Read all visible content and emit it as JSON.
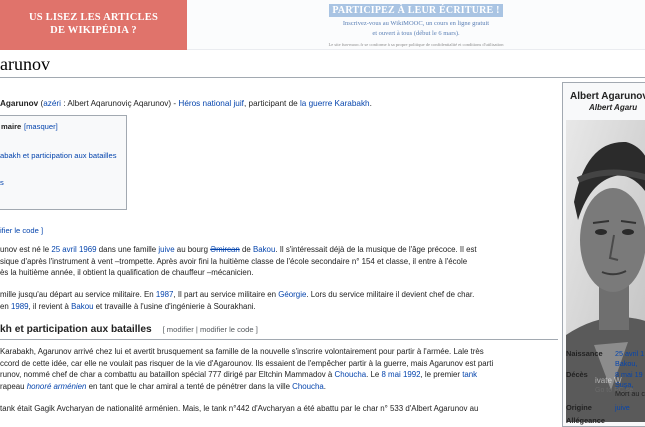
{
  "banner": {
    "left_line1": "US LISEZ LES ARTICLES",
    "left_line2": "DE WIKIPÉDIA ?",
    "headline": "PARTICIPEZ À LEUR ÉCRITURE !",
    "sub1": "Inscrivez-vous au WikiMOOC, un cours en ligne gratuit",
    "sub2": "et ouvert à tous (début le 6 mars).",
    "fine": "Le site fun-mooc.fr se conforme à sa propre politique de confidentialité et conditions d'utilisation"
  },
  "page": {
    "title": "arunov",
    "intro": {
      "name": "Agarunov",
      "lang_link": "azéri",
      "native": ": Albert Aqarunoviç Aqarunov) -",
      "hero_link": "Héros national juif",
      "mid": ", participant de",
      "war_link": "la guerre Karabakh",
      "end": "."
    }
  },
  "toc": {
    "title": "maire",
    "hide": "[masquer]",
    "item1": "abakh et participation aux batailles",
    "item2": "s"
  },
  "edit_code": "ifier le code ]",
  "para1": {
    "l1a": "unov est né le ",
    "l1_date": "25 avril 1969",
    "l1b": " dans une famille ",
    "l1_juive": "juive",
    "l1c": " au bourg ",
    "l1_place": "Əmircan",
    "l1d": " de ",
    "l1_baku": "Bakou",
    "l1e": ". Il s'intéressait déjà de la musique de l'âge précoce. Il est",
    "l2": "sique d'après l'instrument à vent –trompette. Après avoir fini la huitième classe de l'école secondaire n° 154 et classe, il entre à l'école",
    "l3": "ès la huitième année, il obtient la qualification de chauffeur –mécanicien."
  },
  "para2": {
    "l1a": "mille jusqu'au départ au service militaire. En ",
    "l1_year": "1987",
    "l1b": ", Il part au service militaire en ",
    "l1_geo": "Géorgie",
    "l1c": ". Lors du service militaire il devient chef de char.",
    "l2a": "en ",
    "l2_year": "1989",
    "l2b": ", il revient à ",
    "l2_baku": "Bakou",
    "l2c": " et travaille à l'usine d'ingénierie à Sourakhani."
  },
  "section": {
    "heading": "kh et participation aux batailles",
    "edits": "[ modifier | modifier le code ]"
  },
  "para3": {
    "l1": "Karabakh, Agarunov arrivé chez lui et avertit brusquement sa famille de la nouvelle s'inscrire volontairement pour partir à l'armée. Lale très",
    "l2": "ccord de cette idée, car elle ne voulait pas risquer de la vie d'Agarounov. Ils essaient de l'empêcher partir à la guerre, mais Agarunov est parti",
    "l3a": "runov, nommé chef de char a combattu au bataillon spécial 777 dirigé par Eltchin Mammadov à ",
    "l3_choucha": "Choucha",
    "l3b": ". Le ",
    "l3_date": "8 mai 1992",
    "l3c": ", le premier ",
    "l3_tank": "tank",
    "l4a": "rapeau ",
    "l4_honore": "honoré arménien",
    "l4b": " en tant que le char amiral a tenté de pénétrer dans la ville ",
    "l4_choucha": "Choucha",
    "l4c": "."
  },
  "para4": {
    "l1": "tank était Gagik Avcharyan de nationalité arménien. Mais, le tank n°442 d'Avcharyan a été abattu par le char n° 533 d'Albert Agarunov au"
  },
  "infobox": {
    "name": "Albert Agarunov",
    "sub": "Albert Agaru",
    "naissance_label": "Naissance",
    "naissance_date": "25 avril 1",
    "naissance_place": "Bakou,",
    "deces_label": "Décès",
    "deces_date": "8 mai 19",
    "deces_place": "Şuşa,",
    "deces_extra": "Mort au co",
    "origine_label": "Origine",
    "origine_val": "juive",
    "allegeance_label": "Allégeance"
  },
  "watermark": {
    "activate": "ivate W",
    "settings": "Go to PC se"
  },
  "colors": {
    "banner_left": "#e0736b",
    "link": "#0645ad",
    "headline_bg": "#a9c4e3"
  }
}
